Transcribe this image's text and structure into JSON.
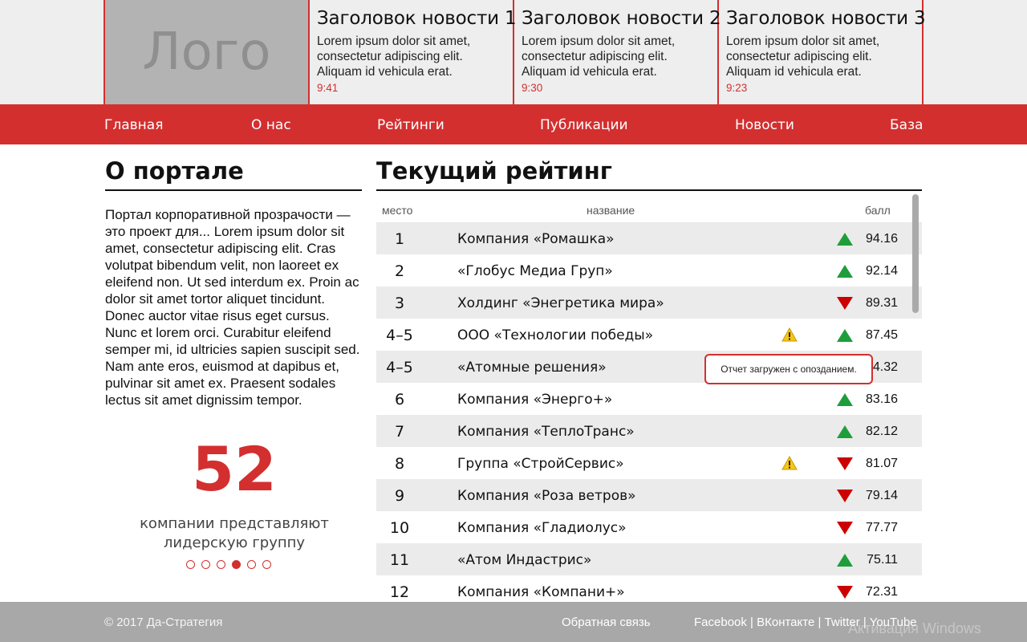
{
  "header": {
    "logo": "Лого",
    "news": [
      {
        "title": "Заголовок новости 1",
        "text": "Lorem ipsum dolor sit amet, consectetur adipiscing elit. Aliquam id vehicula erat.",
        "time": "9:41"
      },
      {
        "title": "Заголовок новости 2",
        "text": "Lorem ipsum dolor sit amet, consectetur adipiscing elit. Aliquam id vehicula erat.",
        "time": "9:30"
      },
      {
        "title": "Заголовок новости 3",
        "text": "Lorem ipsum dolor sit amet, consectetur adipiscing elit. Aliquam id vehicula erat.",
        "time": "9:23"
      }
    ]
  },
  "nav": [
    "Главная",
    "О нас",
    "Рейтинги",
    "Публикации",
    "Новости",
    "База"
  ],
  "about": {
    "title": "О портале",
    "text": "Портал корпоративной прозрачости — это проект для... Lorem ipsum dolor sit amet, consectetur adipiscing elit. Cras volutpat bibendum velit, non laoreet ex eleifend non. Ut sed interdum ex. Proin ac dolor sit amet tortor aliquet tincidunt. Donec auctor vitae risus eget cursus. Nunc et lorem orci. Curabitur eleifend semper mi, id ultricies sapien suscipit sed. Nam ante eros, euismod at dapibus et, pulvinar sit amet ex. Praesent sodales lectus sit amet dignissim tempor.",
    "big_number": "52",
    "caption": "компании представляют лидерскую группу",
    "carousel": {
      "count": 6,
      "active_index": 3
    }
  },
  "rating": {
    "title": "Текущий рейтинг",
    "columns": {
      "place": "место",
      "name": "название",
      "score": "балл"
    },
    "rows": [
      {
        "place": "1",
        "name": "Компания «Ромашка»",
        "trend": "up",
        "score": "94.16",
        "warning": false
      },
      {
        "place": "2",
        "name": "«Глобус Медиа Груп»",
        "trend": "up",
        "score": "92.14",
        "warning": false
      },
      {
        "place": "3",
        "name": "Холдинг «Энегретика мира»",
        "trend": "down",
        "score": "89.31",
        "warning": false
      },
      {
        "place": "4–5",
        "name": "ООО «Технологии победы»",
        "trend": "up",
        "score": "87.45",
        "warning": true
      },
      {
        "place": "4–5",
        "name": "«Атомные решения»",
        "trend": "none",
        "score": "4.32",
        "warning": false
      },
      {
        "place": "6",
        "name": "Компания «Энерго+»",
        "trend": "up",
        "score": "83.16",
        "warning": false
      },
      {
        "place": "7",
        "name": "Компания «ТеплоТранс»",
        "trend": "up",
        "score": "82.12",
        "warning": false
      },
      {
        "place": "8",
        "name": "Группа «СтройСервис»",
        "trend": "down",
        "score": "81.07",
        "warning": true
      },
      {
        "place": "9",
        "name": "Компания «Роза ветров»",
        "trend": "down",
        "score": "79.14",
        "warning": false
      },
      {
        "place": "10",
        "name": "Компания «Гладиолус»",
        "trend": "down",
        "score": "77.77",
        "warning": false
      },
      {
        "place": "11",
        "name": "«Атом Индастрис»",
        "trend": "up",
        "score": "75.11",
        "warning": false
      },
      {
        "place": "12",
        "name": "Компания «Компани+»",
        "trend": "down",
        "score": "72.31",
        "warning": false
      }
    ],
    "tooltip": "Отчет загружен с опозданием."
  },
  "footer": {
    "copyright": "© 2017 Да-Стратегия",
    "feedback": "Обратная связь",
    "social": [
      "Facebook",
      "ВКонтакте",
      "Twitter",
      "YouTube"
    ],
    "watermark": "Активация Windows"
  },
  "colors": {
    "accent": "#d32f2f",
    "up": "#1e9e3a",
    "down": "#cc0000",
    "warning": "#f5c518"
  }
}
